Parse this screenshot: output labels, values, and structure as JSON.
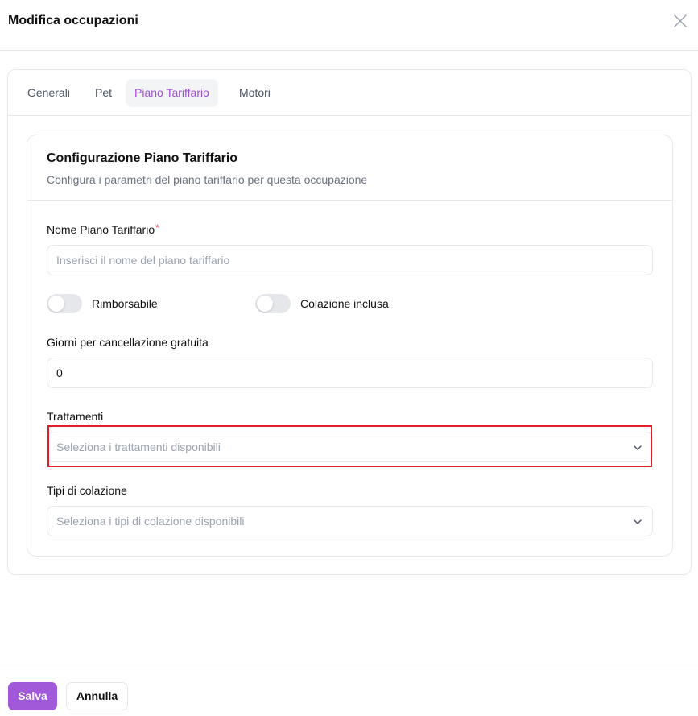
{
  "modal": {
    "title": "Modifica occupazioni",
    "close_icon": "close-icon"
  },
  "tabs": [
    {
      "label": "Generali",
      "active": false
    },
    {
      "label": "Pet",
      "active": false
    },
    {
      "label": "Piano Tariffario",
      "active": true
    },
    {
      "label": "Motori",
      "active": false
    }
  ],
  "config": {
    "title": "Configurazione Piano Tariffario",
    "description": "Configura i parametri del piano tariffario per questa occupazione"
  },
  "form": {
    "name_label": "Nome Piano Tariffario",
    "required_mark": "*",
    "name_value": "",
    "name_placeholder": "Inserisci il nome del piano tariffario",
    "refundable_label": "Rimborsabile",
    "refundable_on": false,
    "breakfast_label": "Colazione inclusa",
    "breakfast_on": false,
    "cancel_days_label": "Giorni per cancellazione gratuita",
    "cancel_days_value": "0",
    "treatments_label": "Trattamenti",
    "treatments_placeholder": "Seleziona i trattamenti disponibili",
    "breakfast_types_label": "Tipi di colazione",
    "breakfast_types_placeholder": "Seleziona i tipi di colazione disponibili"
  },
  "footer": {
    "save_label": "Salva",
    "cancel_label": "Annulla"
  },
  "colors": {
    "accent": "#a259d9",
    "active_tab_text": "#9b4fd1",
    "highlight": "#e11d2a",
    "border": "#e5e7eb"
  }
}
